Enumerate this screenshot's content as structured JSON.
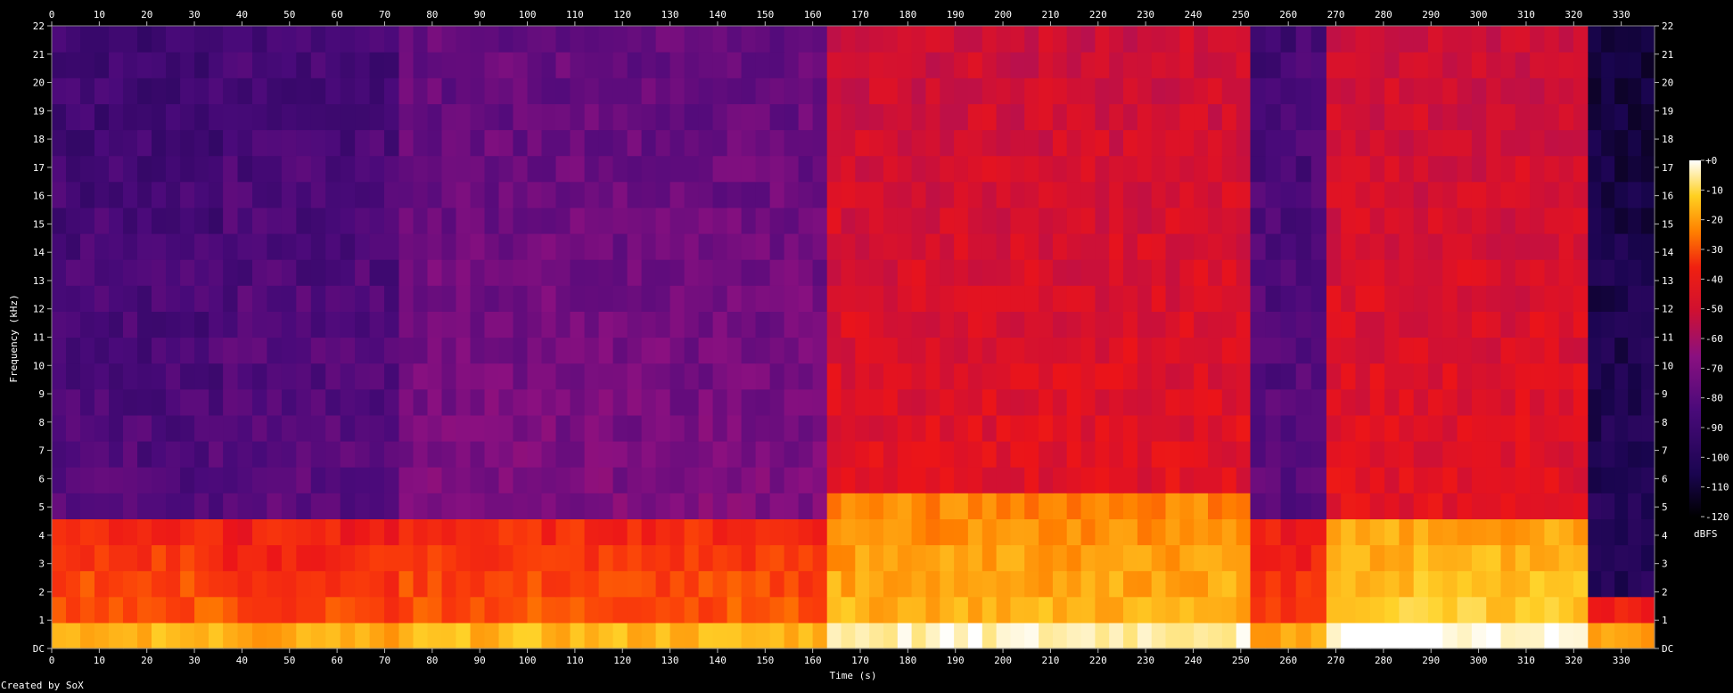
{
  "chart_data": {
    "type": "heatmap",
    "subtype": "spectrogram",
    "title": "",
    "xlabel": "Time (s)",
    "ylabel": "Frequency (kHz)",
    "xlim": [
      0,
      337
    ],
    "ylim": [
      0,
      22
    ],
    "x_ticks": [
      0,
      10,
      20,
      30,
      40,
      50,
      60,
      70,
      80,
      90,
      100,
      110,
      120,
      130,
      140,
      150,
      160,
      170,
      180,
      190,
      200,
      210,
      220,
      230,
      240,
      250,
      260,
      270,
      280,
      290,
      300,
      310,
      320,
      330
    ],
    "y_ticks": [
      "DC",
      "1",
      "2",
      "3",
      "4",
      "5",
      "6",
      "7",
      "8",
      "9",
      "10",
      "11",
      "12",
      "13",
      "14",
      "15",
      "16",
      "17",
      "18",
      "19",
      "20",
      "21",
      "22"
    ],
    "colorbar": {
      "label": "dBFS",
      "ticks": [
        "+0",
        "-10",
        "-20",
        "-30",
        "-40",
        "-50",
        "-60",
        "-70",
        "-80",
        "-90",
        "-100",
        "-110",
        "-120"
      ],
      "range": [
        -120,
        0
      ]
    },
    "sections": [
      {
        "t_start": 0,
        "t_end": 36,
        "low_band_khz": 4.5,
        "low_db": -45,
        "high_db": -90
      },
      {
        "t_start": 36,
        "t_end": 73,
        "low_band_khz": 4.5,
        "low_db": -48,
        "high_db": -88
      },
      {
        "t_start": 73,
        "t_end": 163,
        "low_band_khz": 4.5,
        "low_db": -45,
        "high_db": -80
      },
      {
        "t_start": 163,
        "t_end": 252,
        "low_band_khz": 5.5,
        "low_db": -30,
        "high_db": -55
      },
      {
        "t_start": 252,
        "t_end": 268,
        "low_band_khz": 4.5,
        "low_db": -50,
        "high_db": -88
      },
      {
        "t_start": 268,
        "t_end": 323,
        "low_band_khz": 4.7,
        "low_db": -25,
        "high_db": -55
      },
      {
        "t_start": 323,
        "t_end": 337,
        "low_band_khz": 1.5,
        "low_db": -50,
        "high_db": -105
      }
    ]
  },
  "footer": {
    "credit": "Created by SoX"
  }
}
